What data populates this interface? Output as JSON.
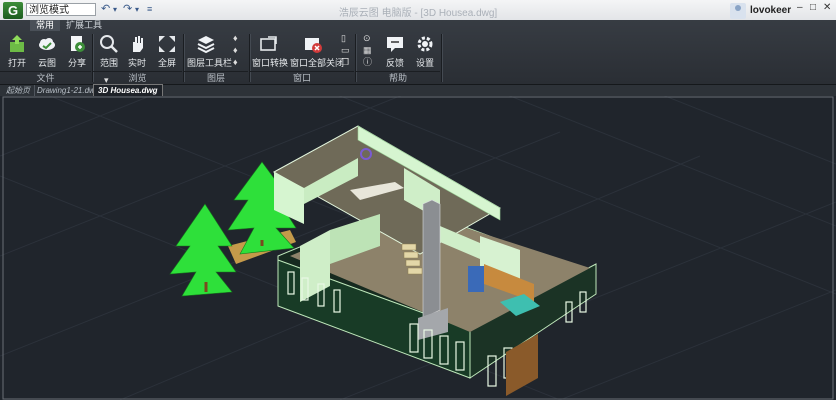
{
  "titlebar": {
    "mode": "浏览模式",
    "title": "浩辰云图 电脑版 - [3D Housea.dwg]",
    "user_name": "lovokeer",
    "window_controls": [
      "–",
      "□",
      "✕"
    ]
  },
  "ribbon": {
    "tabs": [
      {
        "label": "常用",
        "active": true
      },
      {
        "label": "扩展工具",
        "active": false
      }
    ],
    "buttons": {
      "open": "打开",
      "cloud": "云图",
      "share": "分享",
      "range": "范围",
      "realtime": "实时",
      "fullscreen": "全屏",
      "layer_toolbar": "图层工具栏",
      "window_switch": "窗口转换",
      "close_all": "窗口全部关闭",
      "feedback": "反馈",
      "settings": "设置"
    },
    "groups": {
      "file": "文件",
      "browse": "浏览",
      "layer": "图层",
      "window": "窗口",
      "help": "帮助"
    }
  },
  "doc_tabs": [
    {
      "label": "起始页",
      "active": false
    },
    {
      "label": "Drawing1-21.dwg",
      "active": false
    },
    {
      "label": "3D Housea.dwg",
      "active": true
    }
  ],
  "colors": {
    "canvas_bg": "#20252c",
    "wall_green": "#d6f5d0",
    "tree_green": "#2ee03a",
    "accent_green": "#3d8e3a"
  }
}
